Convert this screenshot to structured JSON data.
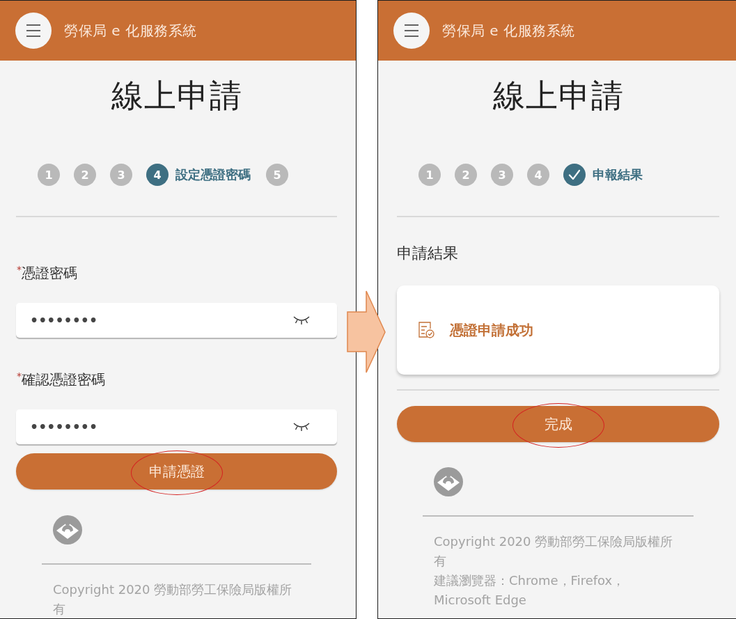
{
  "screens": [
    {
      "kind": "form",
      "header": {
        "title": "勞保局 e 化服務系統"
      },
      "heading": "線上申請",
      "steps": [
        {
          "kind": "number",
          "label": "1",
          "selected": false
        },
        {
          "kind": "number",
          "label": "2",
          "selected": false
        },
        {
          "kind": "number",
          "label": "3",
          "selected": false
        },
        {
          "kind": "number",
          "label": "4",
          "selected": true,
          "caption": "設定憑證密碼"
        },
        {
          "kind": "number",
          "label": "5",
          "selected": false
        }
      ],
      "fields": [
        {
          "label": "憑證密碼",
          "required_mark": "*",
          "value": "••••••••"
        },
        {
          "label": "確認憑證密碼",
          "required_mark": "*",
          "value": "••••••••"
        }
      ],
      "button": {
        "label": "申請憑證",
        "circled": true
      },
      "footer": {
        "lines": [
          "Copyright 2020 勞動部勞工保險局版權所有"
        ]
      }
    },
    {
      "kind": "result",
      "header": {
        "title": "勞保局 e 化服務系統"
      },
      "heading": "線上申請",
      "steps": [
        {
          "kind": "number",
          "label": "1",
          "selected": false
        },
        {
          "kind": "number",
          "label": "2",
          "selected": false
        },
        {
          "kind": "number",
          "label": "3",
          "selected": false
        },
        {
          "kind": "number",
          "label": "4",
          "selected": false
        },
        {
          "kind": "check",
          "selected": true,
          "caption": "申報結果"
        }
      ],
      "result": {
        "title": "申請結果",
        "message": "憑證申請成功"
      },
      "button": {
        "label": "完成",
        "circled": true
      },
      "footer": {
        "lines": [
          "Copyright 2020 勞動部勞工保險局版權所有",
          "建議瀏覽器：Chrome，Firefox，Microsoft Edge"
        ]
      }
    }
  ]
}
